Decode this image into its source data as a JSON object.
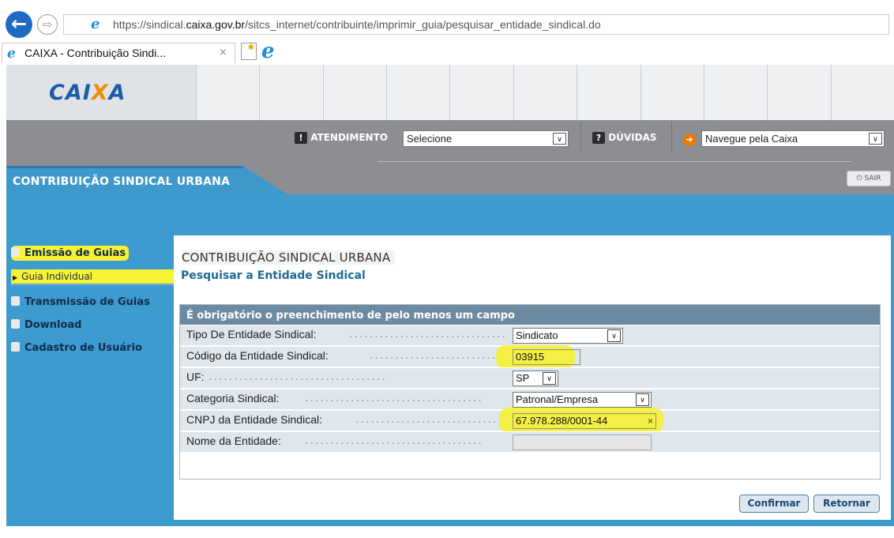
{
  "browser": {
    "url_prefix": "https://sindical.",
    "url_domain": "caixa.gov.br",
    "url_path": "/sitcs_internet/contribuinte/imprimir_guia/pesquisar_entidade_sindical.do",
    "tab_title": "CAIXA - Contribuição Sindi...",
    "tab_close": "×",
    "back_icon": "arrow-left-icon",
    "forward_icon": "arrow-right-icon"
  },
  "header": {
    "logo_left": "CAI",
    "logo_x": "X",
    "logo_right": "A",
    "atendimento_label": "ATENDIMENTO",
    "atendimento_value": "Selecione",
    "duvidas_label": "DÚVIDAS",
    "navegue_value": "Navegue pela Caixa",
    "arrow_glyph": "∨",
    "orange_glyph": "➜",
    "ico_excl": "!",
    "ico_q": "?"
  },
  "section": {
    "title": "CONTRIBUIÇÃO SINDICAL URBANA",
    "sair_label": "SAIR",
    "sair_glyph": "⏻"
  },
  "sidebar": {
    "items": [
      {
        "label": "Emissão de Guias"
      },
      {
        "label": "Transmissão de Guias"
      },
      {
        "label": "Download"
      },
      {
        "label": "Cadastro de Usuário"
      }
    ],
    "sub_item": "Guia Individual",
    "sub_tri": "▶"
  },
  "main": {
    "heading": "CONTRIBUIÇÃO SINDICAL URBANA",
    "subheading": "Pesquisar a Entidade Sindical",
    "form_header": "É obrigatório o preenchimento de pelo menos um campo",
    "dots": "...................................",
    "fields": [
      {
        "label": "Tipo De Entidade Sindical:",
        "value": "Sindicato"
      },
      {
        "label": "Código da Entidade Sindical:",
        "value": "03915"
      },
      {
        "label": "UF:",
        "value": "SP"
      },
      {
        "label": "Categoria Sindical:",
        "value": "Patronal/Empresa"
      },
      {
        "label": "CNPJ da Entidade Sindical:",
        "value": "67.978.288/0001-44",
        "clear": "×"
      },
      {
        "label": "Nome da Entidade:",
        "value": ""
      }
    ],
    "confirm_label": "Confirmar",
    "return_label": "Retornar"
  },
  "colors": {
    "primary_blue": "#3d9bd0",
    "header_gray": "#8c8e91",
    "highlight": "#f7f233",
    "form_head": "#6e8aa2"
  }
}
